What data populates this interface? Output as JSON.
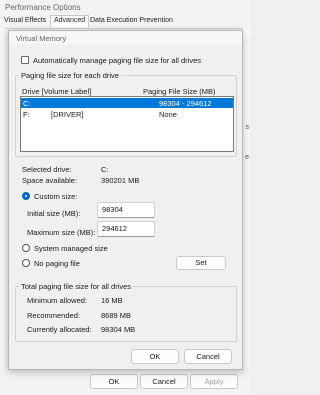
{
  "parent": {
    "title": "Performance Options",
    "tabs": [
      {
        "label": "Visual Effects"
      },
      {
        "label": "Advanced"
      },
      {
        "label": "Data Execution Prevention"
      }
    ],
    "buttons": {
      "ok": "OK",
      "cancel": "Cancel",
      "apply": "Apply"
    }
  },
  "dialog": {
    "title": "Virtual Memory",
    "auto_manage_label": "Automatically manage paging file size for all drives",
    "paging_group_label": "Paging file size for each drive",
    "list_headers": {
      "drive": "Drive  [Volume Label]",
      "size": "Paging File Size (MB)"
    },
    "drives": [
      {
        "drive": "C:",
        "label": "",
        "size": "98304 - 294612"
      },
      {
        "drive": "F:",
        "label": "[DRIVER]",
        "size": "None"
      }
    ],
    "selected_drive_label": "Selected drive:",
    "selected_drive_value": "C:",
    "space_label": "Space available:",
    "space_value": "390201 MB",
    "custom_size_label": "Custom size:",
    "initial_label": "Initial size (MB):",
    "initial_value": "98304",
    "max_label": "Maximum size (MB):",
    "max_value": "294612",
    "system_managed_label": "System managed size",
    "no_paging_label": "No paging file",
    "set_label": "Set",
    "total_group_label": "Total paging file size for all drives",
    "min_label": "Minimum allowed:",
    "min_value": "16 MB",
    "recommended_label": "Recommended:",
    "recommended_value": "8689 MB",
    "allocated_label": "Currently allocated:",
    "allocated_value": "98304 MB",
    "ok_label": "OK",
    "cancel_label": "Cancel"
  }
}
